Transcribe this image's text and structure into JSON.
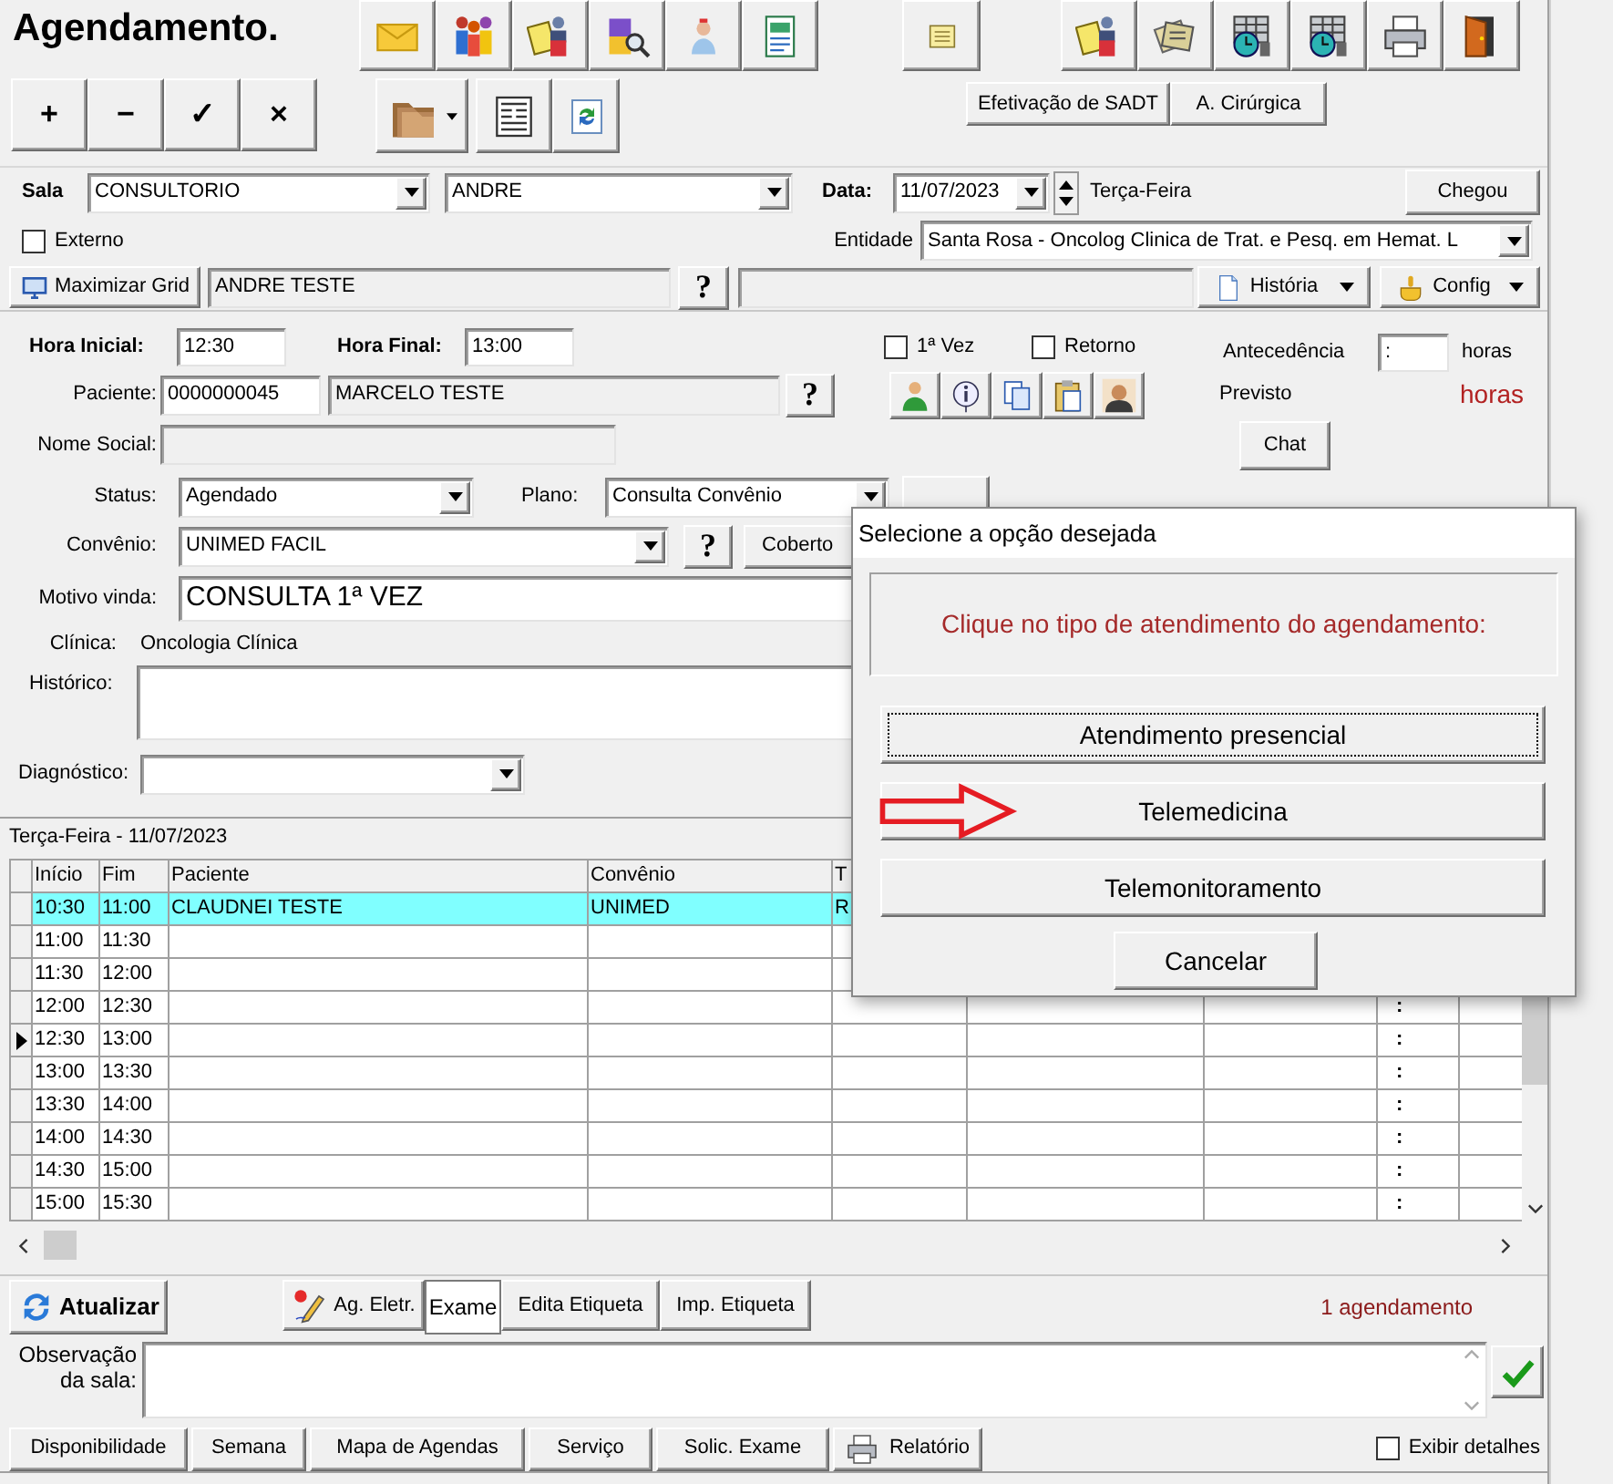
{
  "title": "Agendamento.",
  "record_buttons": [
    "+",
    "−",
    "✓",
    "×"
  ],
  "procedure_buttons": [
    "Efetivação de SADT",
    "A. Cirúrgica"
  ],
  "room_bar": {
    "label": "Sala",
    "room": "CONSULTORIO",
    "professional": "ANDRE",
    "date_label": "Data:",
    "date": "11/07/2023",
    "weekday": "Terça-Feira",
    "arrived_button": "Chegou"
  },
  "external": {
    "label": "Externo",
    "checked": false
  },
  "entity": {
    "label": "Entidade",
    "value": "Santa Rosa - Oncolog Clinica de Trat. e Pesq. em Hemat. L"
  },
  "grid_bar": {
    "maximize_button": "Maximizar Grid",
    "owner": "ANDRE TESTE",
    "help": "?",
    "history_button": "História",
    "config_button": "Config"
  },
  "appointment": {
    "start_label": "Hora Inicial:",
    "start": "12:30",
    "end_label": "Hora Final:",
    "end": "13:00",
    "first_visit": {
      "label": "1ª Vez",
      "checked": false
    },
    "return_visit": {
      "label": "Retorno",
      "checked": false
    },
    "advance_label": "Antecedência",
    "advance": ":",
    "advance_unit": "horas",
    "patient_label": "Paciente:",
    "patient_code": "0000000045",
    "patient_name": "MARCELO TESTE",
    "patient_help": "?",
    "expected_label": "Previsto",
    "expected_unit": "horas",
    "social_name_label": "Nome Social:",
    "chat_button": "Chat",
    "status_label": "Status:",
    "status": "Agendado",
    "plan_label": "Plano:",
    "plan": "Consulta Convênio",
    "insurance_label": "Convênio:",
    "insurance": "UNIMED FACIL",
    "insurance_help": "?",
    "coverage_button": "Coberto",
    "reason_label": "Motivo vinda:",
    "reason": "CONSULTA 1ª VEZ",
    "clinic_label": "Clínica:",
    "clinic": "Oncologia Clínica",
    "history_label": "Histórico:",
    "diagnosis_label": "Diagnóstico:"
  },
  "schedule": {
    "caption": "Terça-Feira - 11/07/2023",
    "columns": [
      "Início",
      "Fim",
      "Paciente",
      "Convênio",
      "T"
    ],
    "rows": [
      {
        "start": "10:30",
        "end": "11:00",
        "patient": "CLAUDNEI TESTE",
        "insurance": "UNIMED",
        "column_5": "R",
        "selected": true,
        "current": false
      },
      {
        "start": "11:00",
        "end": "11:30",
        "selected": false,
        "current": false
      },
      {
        "start": "11:30",
        "end": "12:00",
        "selected": false,
        "current": false
      },
      {
        "start": "12:00",
        "end": "12:30",
        "column_9": ":",
        "selected": false,
        "current": false
      },
      {
        "start": "12:30",
        "end": "13:00",
        "column_9": ":",
        "selected": false,
        "current": true
      },
      {
        "start": "13:00",
        "end": "13:30",
        "column_9": ":",
        "selected": false,
        "current": false
      },
      {
        "start": "13:30",
        "end": "14:00",
        "column_9": ":",
        "selected": false,
        "current": false
      },
      {
        "start": "14:00",
        "end": "14:30",
        "column_9": ":",
        "selected": false,
        "current": false
      },
      {
        "start": "14:30",
        "end": "15:00",
        "column_9": ":",
        "selected": false,
        "current": false
      },
      {
        "start": "15:00",
        "end": "15:30",
        "column_9": ":",
        "selected": false,
        "current": false
      }
    ]
  },
  "actions": {
    "refresh_button": "Atualizar",
    "buttons": [
      {
        "label": "Ag. Eletr.",
        "kind": "with_icon",
        "selected": false
      },
      {
        "label": "Exame",
        "kind": "plain",
        "selected": true
      },
      {
        "label": "Edita Etiqueta",
        "kind": "plain",
        "selected": false
      },
      {
        "label": "Imp. Etiqueta",
        "kind": "plain",
        "selected": false
      }
    ],
    "count": "1 agendamento"
  },
  "room_note": {
    "label": "Observação da sala:"
  },
  "footer": {
    "buttons": [
      {
        "label": "Disponibilidade",
        "kind": "plain"
      },
      {
        "label": "Semana",
        "kind": "plain"
      },
      {
        "label": "Mapa de Agendas",
        "kind": "plain"
      },
      {
        "label": "Serviço",
        "kind": "plain"
      },
      {
        "label": "Solic. Exame",
        "kind": "plain"
      },
      {
        "label": "Relatório",
        "kind": "with_icon"
      }
    ],
    "details": {
      "label": "Exibir detalhes",
      "checked": false
    }
  },
  "dialog": {
    "title": "Selecione a opção desejada",
    "prompt": "Clique no tipo de atendimento do agendamento:",
    "options": [
      {
        "label": "Atendimento presencial",
        "focused": true,
        "marked": false
      },
      {
        "label": "Telemedicina",
        "focused": false,
        "marked": true
      },
      {
        "label": "Telemonitoramento",
        "focused": false,
        "marked": false
      }
    ],
    "cancel_button": "Cancelar"
  }
}
